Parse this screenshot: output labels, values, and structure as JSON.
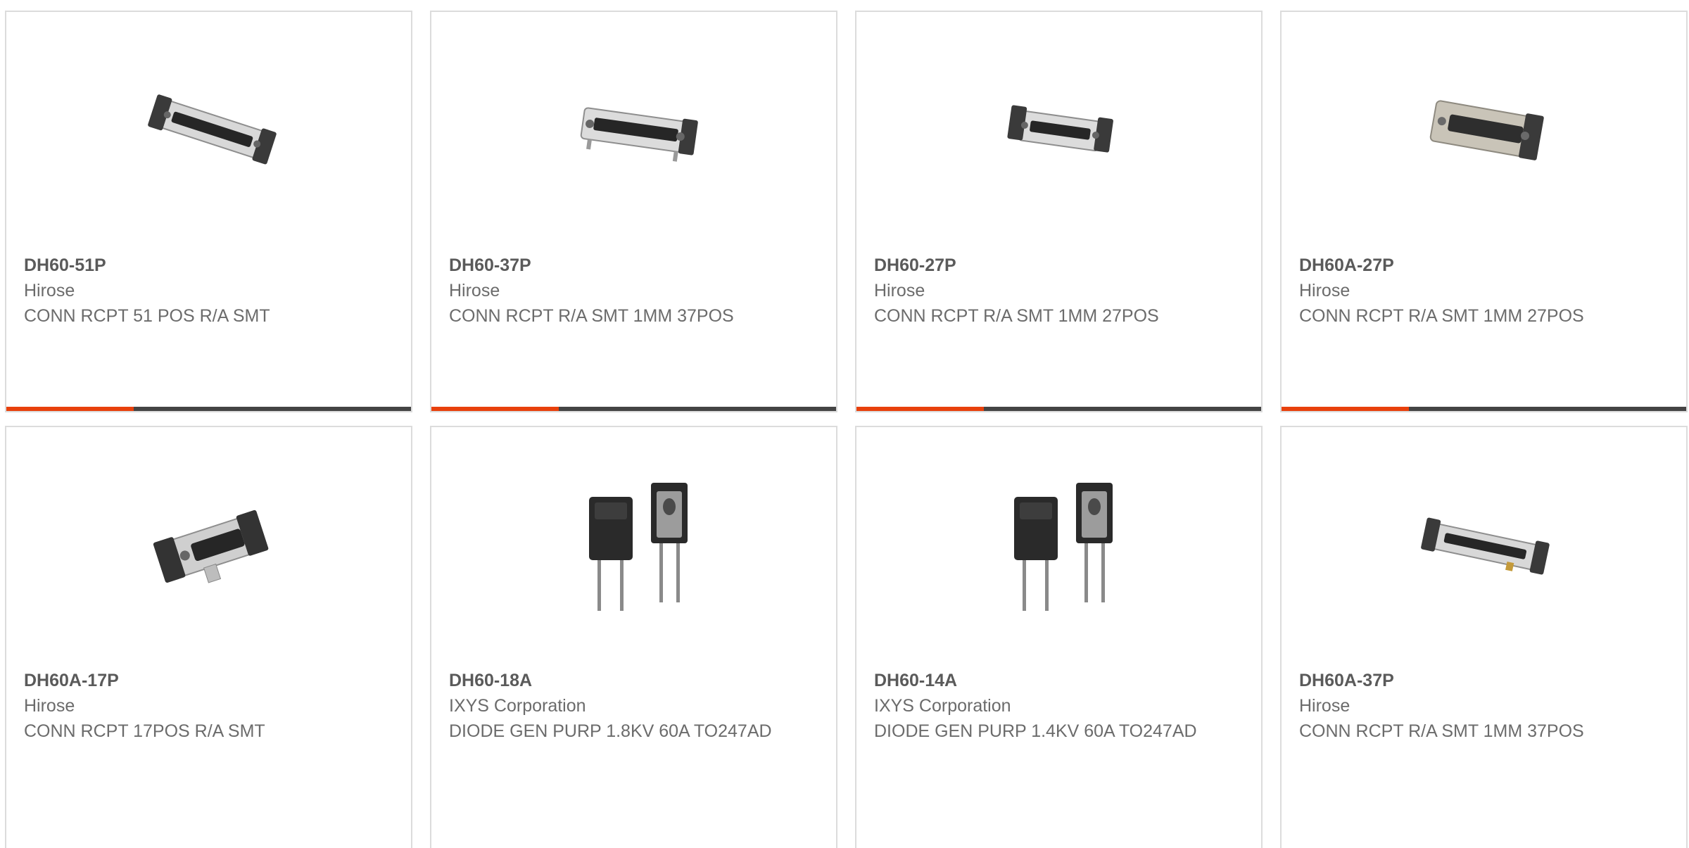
{
  "colors": {
    "accent": "#e8400c",
    "bar": "#444444",
    "border": "#dcdcdc",
    "text": "#6b6b6b"
  },
  "products": [
    {
      "part": "DH60-51P",
      "manufacturer": "Hirose",
      "description": "CONN RCPT 51 POS R/A SMT",
      "icon": "connector-image"
    },
    {
      "part": "DH60-37P",
      "manufacturer": "Hirose",
      "description": "CONN RCPT R/A SMT 1MM 37POS",
      "icon": "connector-image"
    },
    {
      "part": "DH60-27P",
      "manufacturer": "Hirose",
      "description": "CONN RCPT R/A SMT 1MM 27POS",
      "icon": "connector-image"
    },
    {
      "part": "DH60A-27P",
      "manufacturer": "Hirose",
      "description": "CONN RCPT R/A SMT 1MM 27POS",
      "icon": "connector-image"
    },
    {
      "part": "DH60A-17P",
      "manufacturer": "Hirose",
      "description": "CONN RCPT 17POS R/A SMT",
      "icon": "connector-image"
    },
    {
      "part": "DH60-18A",
      "manufacturer": "IXYS Corporation",
      "description": "DIODE GEN PURP 1.8KV 60A TO247AD",
      "icon": "diode-image"
    },
    {
      "part": "DH60-14A",
      "manufacturer": "IXYS Corporation",
      "description": "DIODE GEN PURP 1.4KV 60A TO247AD",
      "icon": "diode-image"
    },
    {
      "part": "DH60A-37P",
      "manufacturer": "Hirose",
      "description": "CONN RCPT R/A SMT 1MM 37POS",
      "icon": "connector-image"
    }
  ]
}
